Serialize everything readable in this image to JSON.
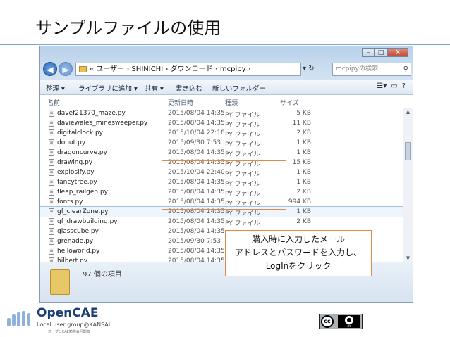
{
  "slide": {
    "title": "サンプルファイルの使用"
  },
  "window": {
    "controls": {
      "minimize": "–",
      "maximize": "□",
      "close": "X"
    },
    "nav": {
      "back": "◀",
      "forward": "▶"
    },
    "address": "« ユーザー › SHINICHI › ダウンロード › mcpipy ›",
    "address_controls": "▾ ↻",
    "search_placeholder": "mcpipyの検索",
    "toolbar": {
      "organize": "整理 ▾",
      "library": "ライブラリに追加 ▾",
      "share": "共有 ▾",
      "burn": "書き込む",
      "new_folder": "新しいフォルダー"
    },
    "columns": {
      "name": "名前",
      "date": "更新日時",
      "type": "種類",
      "size": "サイズ"
    },
    "files": [
      {
        "name": "davef21370_maze.py",
        "date": "2015/08/04 14:35",
        "type": "PY ファイル",
        "size": "5 KB"
      },
      {
        "name": "daviewales_minesweeper.py",
        "date": "2015/08/04 14:35",
        "type": "PY ファイル",
        "size": "11 KB"
      },
      {
        "name": "digitalclock.py",
        "date": "2015/10/04 22:18",
        "type": "PY ファイル",
        "size": "2 KB"
      },
      {
        "name": "donut.py",
        "date": "2015/09/30 7:53",
        "type": "PY ファイル",
        "size": "1 KB"
      },
      {
        "name": "dragoncurve.py",
        "date": "2015/08/04 14:35",
        "type": "PY ファイル",
        "size": "1 KB"
      },
      {
        "name": "drawing.py",
        "date": "2015/08/04 14:35",
        "type": "PY ファイル",
        "size": "15 KB"
      },
      {
        "name": "explosify.py",
        "date": "2015/10/04 22:40",
        "type": "PY ファイル",
        "size": "1 KB"
      },
      {
        "name": "fancytree.py",
        "date": "2015/08/04 14:35",
        "type": "PY ファイル",
        "size": "1 KB"
      },
      {
        "name": "fleap_railgen.py",
        "date": "2015/08/04 14:35",
        "type": "PY ファイル",
        "size": "2 KB"
      },
      {
        "name": "fonts.py",
        "date": "2015/08/04 14:35",
        "type": "PY ファイル",
        "size": "994 KB"
      },
      {
        "name": "gf_clearZone.py",
        "date": "2015/08/04 14:35",
        "type": "PY ファイル",
        "size": "1 KB",
        "selected": true
      },
      {
        "name": "gf_drawbuilding.py",
        "date": "2015/08/04 14:35",
        "type": "PY ファイル",
        "size": "2 KB"
      },
      {
        "name": "glasscube.py",
        "date": "2015/08/04 14:35",
        "type": "",
        "size": ""
      },
      {
        "name": "grenade.py",
        "date": "2015/09/30 7:53",
        "type": "",
        "size": ""
      },
      {
        "name": "helloworld.py",
        "date": "2015/08/04 14:35",
        "type": "",
        "size": ""
      },
      {
        "name": "hilbert.py",
        "date": "2015/08/04 14:35",
        "type": "",
        "size": ""
      }
    ],
    "status": {
      "count": "97 個の項目"
    }
  },
  "callout": {
    "line1": "購入時に入力したメール",
    "line2": "アドレスとパスワードを入力し、",
    "line3": "LogInをクリック"
  },
  "logo": {
    "name": "OpenCAE",
    "sub": "Local user group@KANSAI",
    "sub2": "オープンCAE勉強会＠関西"
  },
  "license": {
    "cc": "cc",
    "by": "BY"
  }
}
